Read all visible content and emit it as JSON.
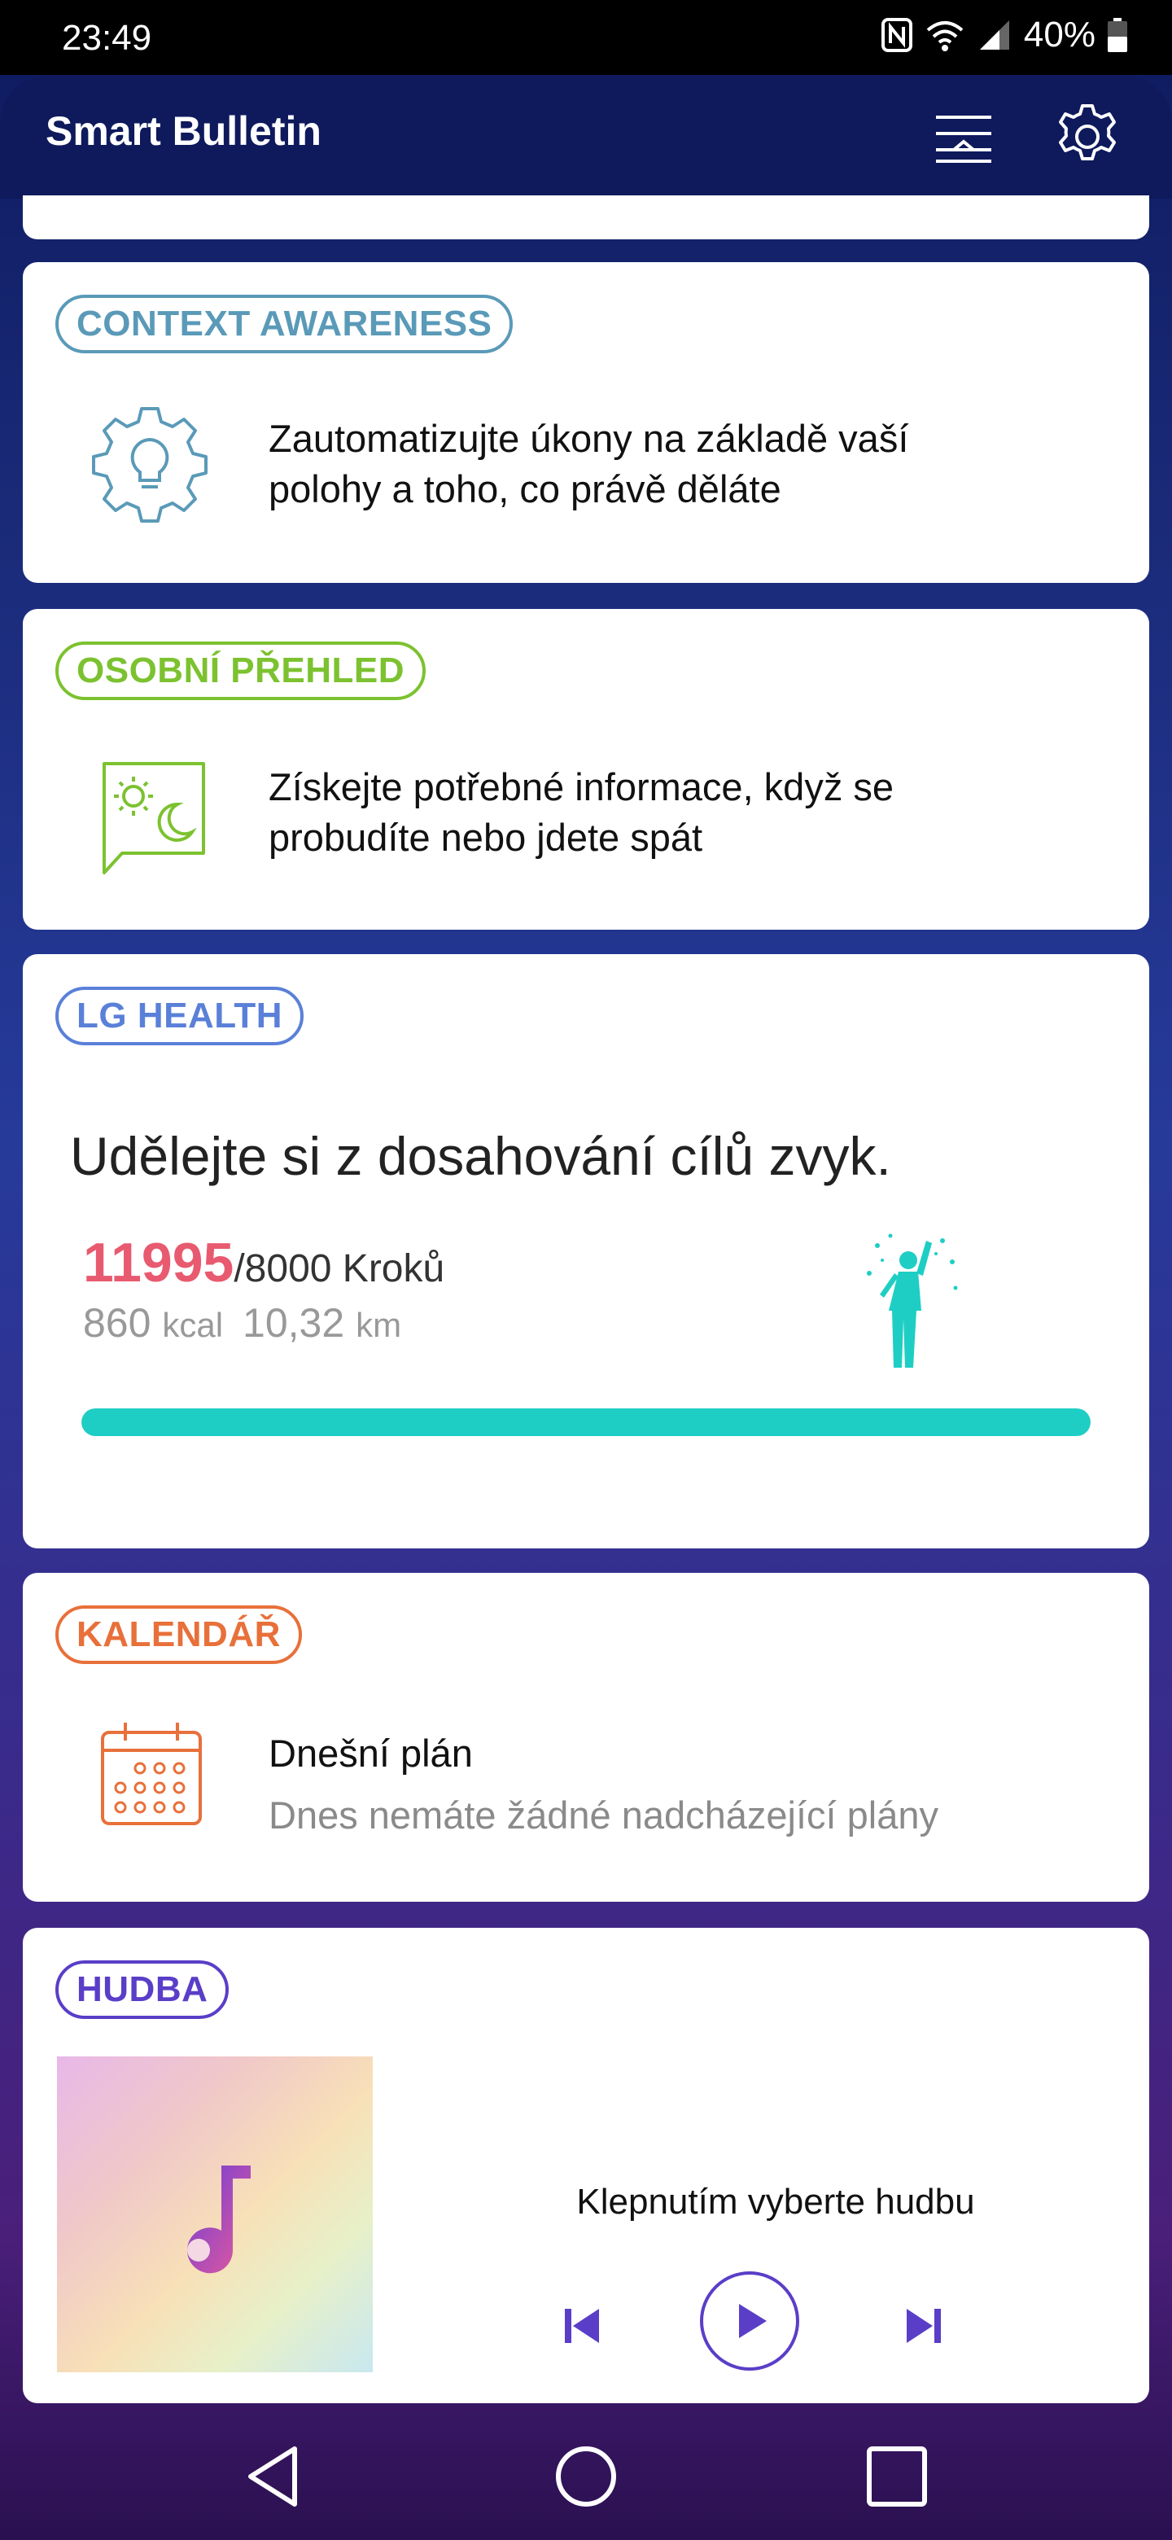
{
  "status_bar": {
    "time": "23:49",
    "battery": "40%"
  },
  "header": {
    "title": "Smart Bulletin"
  },
  "cards": {
    "context": {
      "chip": "CONTEXT AWARENESS",
      "text_line1": "Zautomatizujte úkony na základě vaší",
      "text_line2": "polohy a toho, co právě děláte"
    },
    "overview": {
      "chip": "OSOBNÍ PŘEHLED",
      "text_line1": "Získejte potřebné informace, když se",
      "text_line2": "probudíte nebo jdete spát"
    },
    "health": {
      "chip": "LG HEALTH",
      "title": "Udělejte si z dosahování cílů zvyk.",
      "steps": "11995",
      "steps_goal": "/8000 Kroků",
      "kcal_value": "860",
      "kcal_unit": "kcal",
      "km_value": "10,32",
      "km_unit": "km",
      "progress_fraction": 1.0
    },
    "calendar": {
      "chip": "KALENDÁŘ",
      "title": "Dnešní plán",
      "subtitle": "Dnes nemáte žádné nadcházející plány"
    },
    "music": {
      "chip": "HUDBA",
      "prompt": "Klepnutím vyberte hudbu"
    }
  },
  "colors": {
    "context": "#5a9ab8",
    "overview": "#7cc230",
    "health": "#5a80d8",
    "calendar": "#e8703a",
    "music": "#5a3ec8",
    "steps_accent": "#e85a6f",
    "progress": "#1ecec4"
  },
  "icons": {
    "header": [
      "filter-icon",
      "gear-icon"
    ],
    "nav": [
      "back-icon",
      "home-icon",
      "recents-icon"
    ]
  }
}
